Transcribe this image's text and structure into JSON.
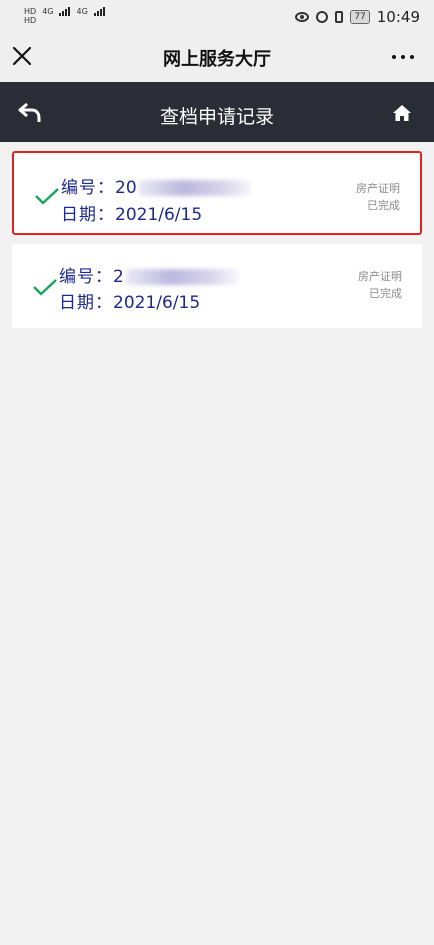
{
  "statusbar": {
    "line1": "HD",
    "line2": "HD",
    "net1": "4G",
    "net2": "4G",
    "battery": "77",
    "time": "10:49"
  },
  "titlebar": {
    "title": "网上服务大厅"
  },
  "navbar": {
    "title": "查档申请记录"
  },
  "records": [
    {
      "number_label": "编号：",
      "number_visible": "20",
      "date_label": "日期：",
      "date": "2021/6/15",
      "type": "房产证明",
      "status": "已完成"
    },
    {
      "number_label": "编号：",
      "number_visible": "2",
      "date_label": "日期：",
      "date": "2021/6/15",
      "type": "房产证明",
      "status": "已完成"
    }
  ],
  "colors": {
    "navbar_bg": "#2a2c36",
    "check_green": "#1aa35a",
    "text_blue": "#1e2a8a",
    "highlight_red": "#e0231e"
  }
}
